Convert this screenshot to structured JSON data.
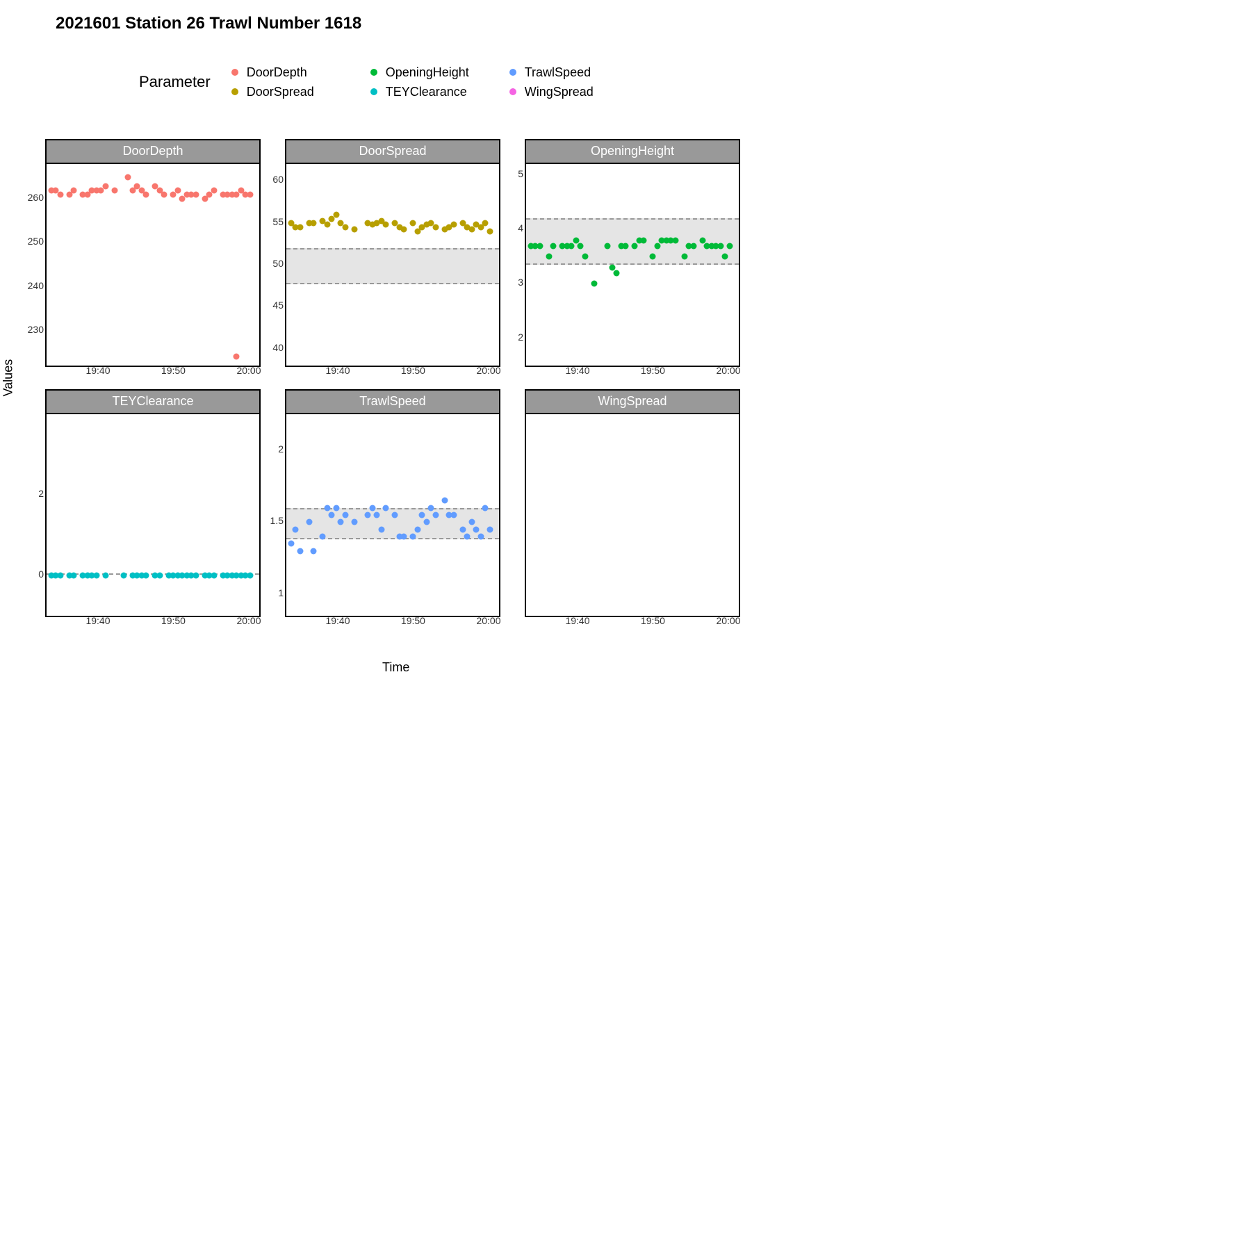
{
  "title": "2021601 Station 26  Trawl Number 1618",
  "legend_title": "Parameter",
  "legend": [
    {
      "label": "DoorDepth",
      "color": "#F8766D"
    },
    {
      "label": "OpeningHeight",
      "color": "#00BA38"
    },
    {
      "label": "TrawlSpeed",
      "color": "#619CFF"
    },
    {
      "label": "DoorSpread",
      "color": "#B79F00"
    },
    {
      "label": "TEYClearance",
      "color": "#00BFC4"
    },
    {
      "label": "WingSpread",
      "color": "#F564E3"
    }
  ],
  "axis_labels": {
    "x": "Time",
    "y": "Values"
  },
  "x_time": {
    "min": 19.55,
    "max": 20.02,
    "ticks": [
      {
        "v": 19.6667,
        "label": "19:40"
      },
      {
        "v": 19.8333,
        "label": "19:50"
      },
      {
        "v": 20.0,
        "label": "20:00"
      }
    ]
  },
  "chart_data": [
    {
      "name": "DoorDepth",
      "color": "#F8766D",
      "type": "scatter",
      "ylim": [
        222,
        268
      ],
      "yticks": [
        230,
        240,
        250,
        260
      ],
      "x": [
        19.56,
        19.57,
        19.58,
        19.6,
        19.61,
        19.63,
        19.64,
        19.65,
        19.66,
        19.67,
        19.68,
        19.7,
        19.73,
        19.74,
        19.75,
        19.76,
        19.77,
        19.79,
        19.8,
        19.81,
        19.83,
        19.84,
        19.85,
        19.86,
        19.87,
        19.88,
        19.9,
        19.91,
        19.92,
        19.94,
        19.95,
        19.96,
        19.97,
        19.98,
        19.99,
        20.0,
        19.97
      ],
      "y": [
        262,
        262,
        261,
        261,
        262,
        261,
        261,
        262,
        262,
        262,
        263,
        262,
        265,
        262,
        263,
        262,
        261,
        263,
        262,
        261,
        261,
        262,
        260,
        261,
        261,
        261,
        260,
        261,
        262,
        261,
        261,
        261,
        261,
        262,
        261,
        261,
        224
      ]
    },
    {
      "name": "DoorSpread",
      "color": "#B79F00",
      "type": "scatter",
      "ylim": [
        38,
        62
      ],
      "yticks": [
        40,
        45,
        50,
        55,
        60
      ],
      "band": [
        48,
        52
      ],
      "x": [
        19.56,
        19.57,
        19.58,
        19.6,
        19.61,
        19.63,
        19.64,
        19.65,
        19.66,
        19.67,
        19.68,
        19.7,
        19.73,
        19.74,
        19.75,
        19.76,
        19.77,
        19.79,
        19.8,
        19.81,
        19.83,
        19.84,
        19.85,
        19.86,
        19.87,
        19.88,
        19.9,
        19.91,
        19.92,
        19.94,
        19.95,
        19.96,
        19.97,
        19.98,
        19.99,
        20.0
      ],
      "y": [
        55,
        54.5,
        54.5,
        55,
        55,
        55.2,
        54.8,
        55.5,
        56,
        55,
        54.5,
        54.2,
        55,
        54.8,
        55,
        55.2,
        54.8,
        55,
        54.5,
        54.2,
        55,
        54,
        54.5,
        54.8,
        55,
        54.5,
        54.2,
        54.5,
        54.8,
        55,
        54.5,
        54.2,
        54.8,
        54.5,
        55,
        54
      ]
    },
    {
      "name": "OpeningHeight",
      "color": "#00BA38",
      "type": "scatter",
      "ylim": [
        1.5,
        5.2
      ],
      "yticks": [
        2,
        3,
        4,
        5
      ],
      "band": [
        3.4,
        4.2
      ],
      "x": [
        19.56,
        19.57,
        19.58,
        19.6,
        19.61,
        19.63,
        19.64,
        19.65,
        19.66,
        19.67,
        19.68,
        19.7,
        19.73,
        19.74,
        19.75,
        19.76,
        19.77,
        19.79,
        19.8,
        19.81,
        19.83,
        19.84,
        19.85,
        19.86,
        19.87,
        19.88,
        19.9,
        19.91,
        19.92,
        19.94,
        19.95,
        19.96,
        19.97,
        19.98,
        19.99,
        20.0
      ],
      "y": [
        3.7,
        3.7,
        3.7,
        3.5,
        3.7,
        3.7,
        3.7,
        3.7,
        3.8,
        3.7,
        3.5,
        3.0,
        3.7,
        3.3,
        3.2,
        3.7,
        3.7,
        3.7,
        3.8,
        3.8,
        3.5,
        3.7,
        3.8,
        3.8,
        3.8,
        3.8,
        3.5,
        3.7,
        3.7,
        3.8,
        3.7,
        3.7,
        3.7,
        3.7,
        3.5,
        3.7
      ]
    },
    {
      "name": "TEYClearance",
      "color": "#00BFC4",
      "type": "scatter",
      "ylim": [
        -1.0,
        4.0
      ],
      "yticks": [
        0,
        2
      ],
      "dashed_line": 0.05,
      "x": [
        19.56,
        19.57,
        19.58,
        19.6,
        19.61,
        19.63,
        19.64,
        19.65,
        19.66,
        19.68,
        19.72,
        19.74,
        19.75,
        19.76,
        19.77,
        19.79,
        19.8,
        19.82,
        19.83,
        19.84,
        19.85,
        19.86,
        19.87,
        19.88,
        19.9,
        19.91,
        19.92,
        19.94,
        19.95,
        19.96,
        19.97,
        19.98,
        19.99,
        20.0
      ],
      "y": [
        0,
        0,
        0,
        0,
        0,
        0,
        0,
        0,
        0,
        0,
        0,
        0,
        0,
        0,
        0,
        0,
        0,
        0,
        0,
        0,
        0,
        0,
        0,
        0,
        0,
        0,
        0,
        0,
        0,
        0,
        0,
        0,
        0,
        0
      ]
    },
    {
      "name": "TrawlSpeed",
      "color": "#619CFF",
      "type": "scatter",
      "ylim": [
        0.85,
        2.25
      ],
      "yticks": [
        1.0,
        1.5,
        2.0
      ],
      "band": [
        1.4,
        1.6
      ],
      "x": [
        19.56,
        19.57,
        19.58,
        19.6,
        19.61,
        19.63,
        19.64,
        19.65,
        19.66,
        19.67,
        19.68,
        19.7,
        19.73,
        19.74,
        19.75,
        19.76,
        19.77,
        19.79,
        19.8,
        19.81,
        19.83,
        19.84,
        19.85,
        19.86,
        19.87,
        19.88,
        19.9,
        19.91,
        19.92,
        19.94,
        19.95,
        19.96,
        19.97,
        19.98,
        19.99,
        20.0
      ],
      "y": [
        1.35,
        1.45,
        1.3,
        1.5,
        1.3,
        1.4,
        1.6,
        1.55,
        1.6,
        1.5,
        1.55,
        1.5,
        1.55,
        1.6,
        1.55,
        1.45,
        1.6,
        1.55,
        1.4,
        1.4,
        1.4,
        1.45,
        1.55,
        1.5,
        1.6,
        1.55,
        1.65,
        1.55,
        1.55,
        1.45,
        1.4,
        1.5,
        1.45,
        1.4,
        1.6,
        1.45
      ]
    },
    {
      "name": "WingSpread",
      "color": "#F564E3",
      "type": "scatter",
      "ylim": [
        0,
        1
      ],
      "yticks": [],
      "x": [],
      "y": []
    }
  ]
}
